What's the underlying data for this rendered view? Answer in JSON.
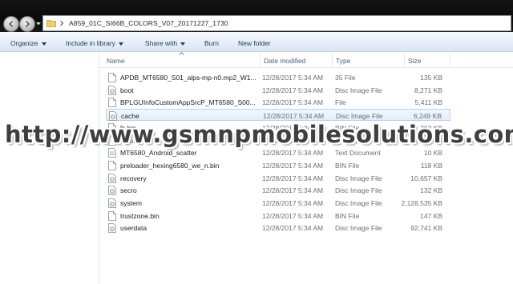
{
  "address_bar": {
    "path": "A859_01C_SI66B_COLORS_V07_20171227_1730"
  },
  "toolbar": {
    "items": [
      {
        "label": "Organize",
        "has_dropdown": true
      },
      {
        "label": "Include in library",
        "has_dropdown": true
      },
      {
        "label": "Share with",
        "has_dropdown": true
      },
      {
        "label": "Burn",
        "has_dropdown": false
      },
      {
        "label": "New folder",
        "has_dropdown": false
      }
    ]
  },
  "columns": {
    "name": "Name",
    "date": "Date modified",
    "type": "Type",
    "size": "Size"
  },
  "files": [
    {
      "name": "APDB_MT6580_S01_alps-mp-n0.mp2_W1...",
      "date": "12/28/2017 5:34 AM",
      "type": "35 File",
      "size": "135 KB",
      "icon": "generic-file-icon"
    },
    {
      "name": "boot",
      "date": "12/28/2017 5:34 AM",
      "type": "Disc Image File",
      "size": "8,271 KB",
      "icon": "disc-image-icon"
    },
    {
      "name": "BPLGUInfoCustomAppSrcP_MT6580_S00...",
      "date": "12/28/2017 5:34 AM",
      "type": "File",
      "size": "5,411 KB",
      "icon": "generic-file-icon"
    },
    {
      "name": "cache",
      "date": "12/28/2017 5:34 AM",
      "type": "Disc Image File",
      "size": "6,249 KB",
      "icon": "disc-image-icon",
      "selected": true
    },
    {
      "name": "lk.bin",
      "date": "12/28/2017 5:34 AM",
      "type": "BIN File",
      "size": "262 KB",
      "icon": "generic-file-icon"
    },
    {
      "name": "logo.bin",
      "date": "12/28/2017 5:34 AM",
      "type": "BIN File",
      "size": "1,024 KB",
      "icon": "generic-file-icon"
    },
    {
      "name": "MT6580_Android_scatter",
      "date": "12/28/2017 5:34 AM",
      "type": "Text Document",
      "size": "10 KB",
      "icon": "text-document-icon"
    },
    {
      "name": "preloader_hexing6580_we_n.bin",
      "date": "12/28/2017 5:34 AM",
      "type": "BIN File",
      "size": "118 KB",
      "icon": "generic-file-icon"
    },
    {
      "name": "recovery",
      "date": "12/28/2017 5:34 AM",
      "type": "Disc Image File",
      "size": "10,657 KB",
      "icon": "disc-image-icon"
    },
    {
      "name": "secro",
      "date": "12/28/2017 5:34 AM",
      "type": "Disc Image File",
      "size": "132 KB",
      "icon": "disc-image-icon"
    },
    {
      "name": "system",
      "date": "12/28/2017 5:34 AM",
      "type": "Disc Image File",
      "size": "2,128,535 KB",
      "icon": "disc-image-icon"
    },
    {
      "name": "trustzone.bin",
      "date": "12/28/2017 5:34 AM",
      "type": "BIN File",
      "size": "147 KB",
      "icon": "generic-file-icon"
    },
    {
      "name": "userdata",
      "date": "12/28/2017 5:34 AM",
      "type": "Disc Image File",
      "size": "92,741 KB",
      "icon": "disc-image-icon"
    }
  ],
  "watermark": "http://www.gsmnpmobilesolutions.com/",
  "colors": {
    "titlebar": "#111111",
    "toolbar_text": "#1e395b",
    "selection_border": "#b7d0ec",
    "column_header_text": "#4c607a"
  }
}
